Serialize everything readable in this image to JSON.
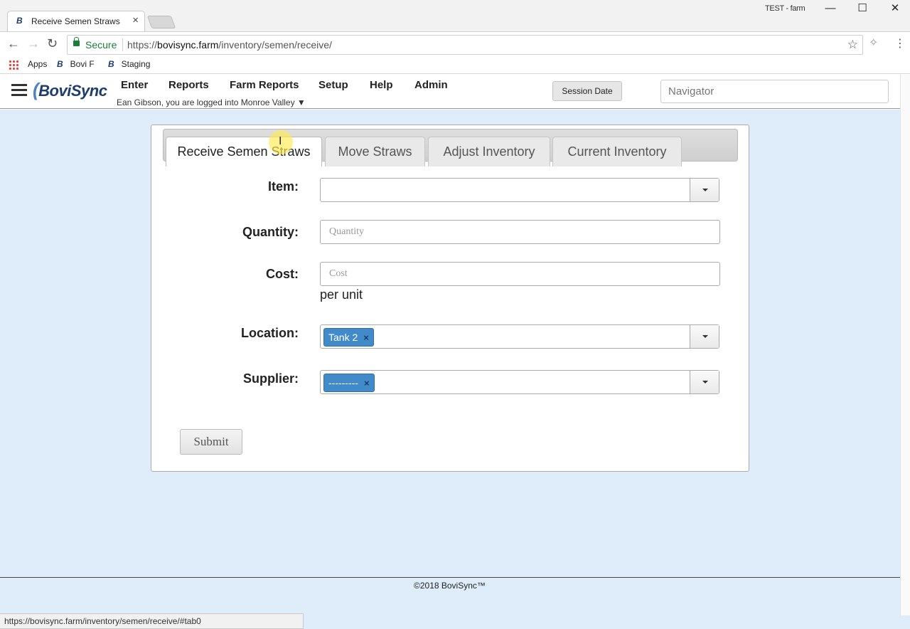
{
  "browser": {
    "tab_title": "Receive Semen Straws",
    "tab_favicon": "B",
    "profile": "TEST - farm",
    "secure_label": "Secure",
    "url_scheme": "https://",
    "url_host": "bovisync.farm",
    "url_path": "/inventory/semen/receive/",
    "bookmarks": [
      "Apps",
      "Bovi F",
      "Staging"
    ],
    "status_url": "https://bovisync.farm/inventory/semen/receive/#tab0"
  },
  "app": {
    "logo": "BoviSync",
    "nav": [
      "Enter",
      "Reports",
      "Farm Reports",
      "Setup",
      "Help",
      "Admin"
    ],
    "login_text": "Ean Gibson, you are logged into Monroe Valley ▼",
    "session_date_label": "Session Date",
    "navigator_placeholder": "Navigator"
  },
  "tabs": [
    "Receive Semen Straws",
    "Move Straws",
    "Adjust Inventory",
    "Current Inventory"
  ],
  "form": {
    "item_label": "Item:",
    "quantity_label": "Quantity:",
    "quantity_placeholder": "Quantity",
    "cost_label": "Cost:",
    "cost_placeholder": "Cost",
    "per_unit": "per unit",
    "location_label": "Location:",
    "location_value": "Tank 2",
    "supplier_label": "Supplier:",
    "supplier_value": "---------",
    "chip_remove": "×",
    "submit_label": "Submit"
  },
  "footer": {
    "copyright": "©2018 BoviSync™"
  }
}
